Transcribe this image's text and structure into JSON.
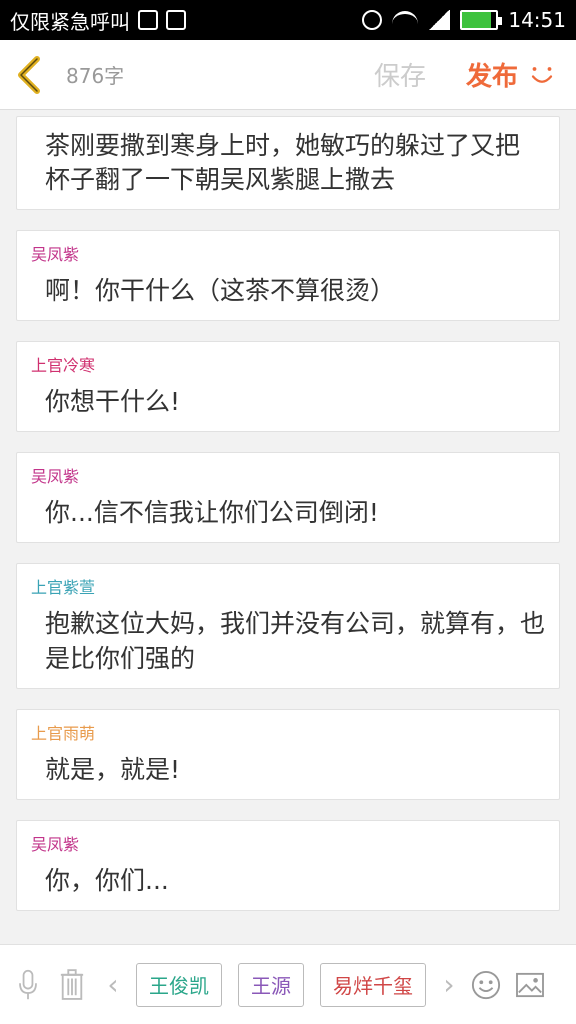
{
  "status_bar": {
    "carrier": "仅限紧急呼叫",
    "time": "14:51"
  },
  "toolbar": {
    "word_count": "876字",
    "save_label": "保存",
    "publish_label": "发布"
  },
  "messages": [
    {
      "speaker": "",
      "text": "茶刚要撒到寒身上时，她敏巧的躲过了又把杯子翻了一下朝吴风紫腿上撒去",
      "color": "#333333"
    },
    {
      "speaker": "吴凤紫",
      "text": "啊！你干什么（这茶不算很烫）",
      "color": "#c2348a"
    },
    {
      "speaker": "上官冷寒",
      "text": "你想干什么!",
      "color": "#d0306f"
    },
    {
      "speaker": "吴凤紫",
      "text": "你...信不信我让你们公司倒闭!",
      "color": "#c2348a"
    },
    {
      "speaker": "上官紫萱",
      "text": "抱歉这位大妈，我们并没有公司，就算有，也是比你们强的",
      "color": "#3aa3b5"
    },
    {
      "speaker": "上官雨萌",
      "text": "就是，就是!",
      "color": "#e89b4c"
    },
    {
      "speaker": "吴凤紫",
      "text": "你，你们...",
      "color": "#c2348a"
    }
  ],
  "bottom_bar": {
    "characters": [
      {
        "label": "王俊凯",
        "color": "#2aa68a"
      },
      {
        "label": "王源",
        "color": "#8a58b8"
      },
      {
        "label": "易烊千玺",
        "color": "#d04646"
      }
    ]
  },
  "colors": {
    "accent": "#ef6a3a",
    "back_arrow": "#e0b020"
  }
}
